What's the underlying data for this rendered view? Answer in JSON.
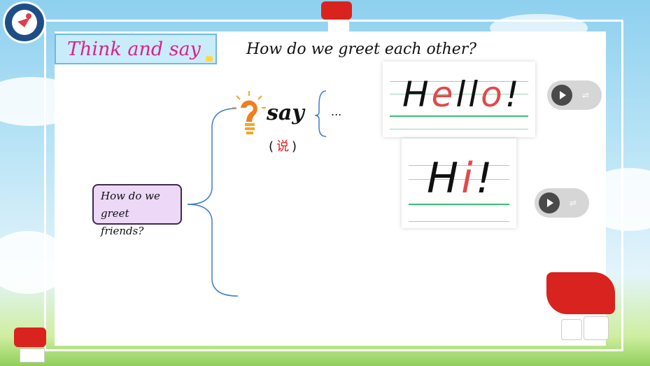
{
  "slide": {
    "title": "Think and say",
    "question": "How do we greet each other?",
    "topic_box": {
      "line1": "How do we",
      "line2": "greet friends?"
    },
    "say_label": "say",
    "chinese": {
      "open": "(",
      "char": "说",
      "close": ")"
    },
    "ellipsis": "...",
    "words": [
      {
        "prefix": "H",
        "red1": "e",
        "mid": "ll",
        "red2": "o",
        "suffix": "!"
      },
      {
        "prefix": "H",
        "red1": "i",
        "mid": "",
        "red2": "",
        "suffix": "!"
      }
    ]
  },
  "colors": {
    "title_pink": "#e0208a",
    "accent_red": "#e04a4a",
    "guide_green": "#3bbf76",
    "panel_blue": "#c9ecfb"
  },
  "icons": [
    "lightbulb-question-icon",
    "play-icon",
    "equalizer-icon",
    "school-logo-icon",
    "badge-icon"
  ]
}
